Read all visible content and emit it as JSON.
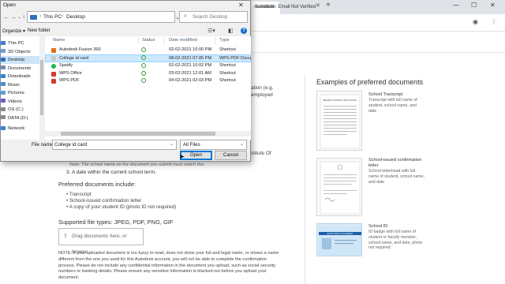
{
  "browser": {
    "tabs": [
      {
        "label": "Autodesk",
        "active": true
      },
      {
        "label": "Autodesk - Email Not Verified",
        "active": false
      }
    ],
    "new_tab": "+",
    "controls": {
      "minimize": "—",
      "maximize": "☐",
      "close": "✕"
    }
  },
  "background_page": {
    "fragments": {
      "line1": "ation (e.g.",
      "line2": "employed",
      "line3": "stitute Of"
    },
    "requirement": "3. A date within the current school term.",
    "note": "Note: The school name on the document you submit must match this.",
    "preferred_title": "Preferred documents include:",
    "preferred_items": [
      "Transcript",
      "School-issued confirmation letter",
      "A copy of your student ID (photo ID not required)"
    ],
    "filetypes": "Supported file types: JPEG, PDF, PNG, GIF",
    "dropzone": "Drag documents here, or browse",
    "notice": "NOTE: If your uploaded document is too fuzzy to read, does not show your full and legal name, or shows a name different from the one you used for this Autodesk account, you will not be able to complete the confirmation process. Please do not include any confidential information in the document you upload, such as social security numbers or banking details. Please ensure any sensitive information is blacked out before you upload your document.",
    "examples_title": "Examples of preferred documents",
    "examples": [
      {
        "title": "School Transcript",
        "desc": "Transcript with full name of student, school name, and date",
        "thumb_text": "BELMONT CENTRAL HIGH SCHOOL"
      },
      {
        "title": "School-issued confirmation letter",
        "desc": "School letterhead with full name of student, school name, and date",
        "thumb_text": ""
      },
      {
        "title": "School ID",
        "desc": "ID badge with full name of student or faculty member, school name, and date, photo not required",
        "thumb_text": "EAST WEST ACADEMY"
      }
    ]
  },
  "dialog": {
    "title": "Open",
    "path": [
      "This PC",
      "Desktop"
    ],
    "search_placeholder": "Search Desktop",
    "toolbar": {
      "organize": "Organize ▾",
      "new_folder": "New folder"
    },
    "nav_items": [
      {
        "label": "This PC",
        "icon": "pc-icon",
        "selected": false
      },
      {
        "label": "3D Objects",
        "icon": "cube-icon",
        "selected": false
      },
      {
        "label": "Desktop",
        "icon": "desktop-icon",
        "selected": true
      },
      {
        "label": "Documents",
        "icon": "documents-icon",
        "selected": false
      },
      {
        "label": "Downloads",
        "icon": "downloads-icon",
        "selected": false
      },
      {
        "label": "Music",
        "icon": "music-icon",
        "selected": false
      },
      {
        "label": "Pictures",
        "icon": "pictures-icon",
        "selected": false
      },
      {
        "label": "Videos",
        "icon": "videos-icon",
        "selected": false
      },
      {
        "label": "OS (C:)",
        "icon": "drive-icon",
        "selected": false
      },
      {
        "label": "DATA (D:)",
        "icon": "drive-icon",
        "selected": false
      },
      {
        "label": "Network",
        "icon": "network-icon",
        "selected": false
      }
    ],
    "columns": {
      "name": "Name",
      "status": "Status",
      "date": "Date modified",
      "type": "Type"
    },
    "files": [
      {
        "name": "Autodesk Fusion 360",
        "date": "02-02-2021 10:00 PM",
        "type": "Shortcut",
        "selected": false,
        "icon_color": "#e0701e"
      },
      {
        "name": "College id card",
        "date": "08-02-2021 07:05 PM",
        "type": "WPS PDF Document",
        "selected": true,
        "icon_color": "#c8c8c8"
      },
      {
        "name": "Spotify",
        "date": "02-02-2021 10:02 PM",
        "type": "Shortcut",
        "selected": false,
        "icon_color": "#1db954"
      },
      {
        "name": "WPS Office",
        "date": "03-02-2021 12:01 AM",
        "type": "Shortcut",
        "selected": false,
        "icon_color": "#d33b2c"
      },
      {
        "name": "WPS PDF",
        "date": "04-02-2021 02:03 PM",
        "type": "Shortcut",
        "selected": false,
        "icon_color": "#d33b2c"
      }
    ],
    "file_name_label": "File name:",
    "file_name_value": "College id card",
    "file_type": "All Files",
    "open_button": "Open",
    "cancel_button": "Cancel"
  }
}
